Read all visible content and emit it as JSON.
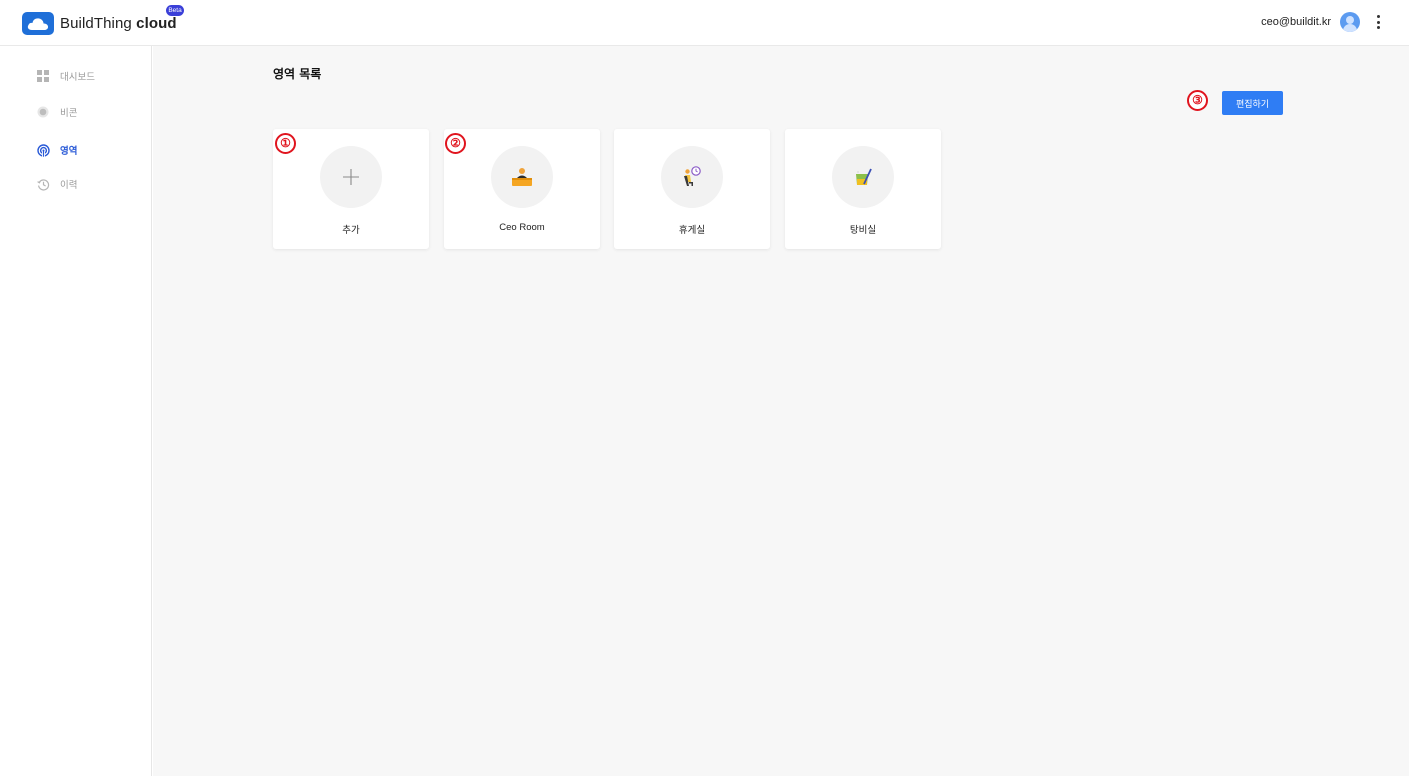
{
  "header": {
    "brand_light": "BuildThing",
    "brand_bold": "cloud",
    "beta": "Beta",
    "user_email": "ceo@buildit.kr"
  },
  "sidebar": {
    "items": [
      {
        "label": "대시보드",
        "icon": "dashboard-grid-icon",
        "active": false
      },
      {
        "label": "비콘",
        "icon": "beacon-icon",
        "active": false
      },
      {
        "label": "영역",
        "icon": "area-signal-icon",
        "active": true
      },
      {
        "label": "이력",
        "icon": "history-clock-icon",
        "active": false
      }
    ]
  },
  "main": {
    "title": "영역 목록",
    "edit_button": "편집하기",
    "cards": [
      {
        "label": "추가",
        "icon": "plus-icon"
      },
      {
        "label": "Ceo Room",
        "icon": "ceo-desk-icon"
      },
      {
        "label": "휴게실",
        "icon": "lounge-chair-icon"
      },
      {
        "label": "탕비실",
        "icon": "pantry-icon"
      }
    ],
    "markers": [
      "①",
      "②",
      "③"
    ]
  },
  "colors": {
    "accent": "#2f7df4",
    "brand": "#1f6fd8",
    "active_nav": "#2b5bd7",
    "marker": "#e0141e"
  }
}
